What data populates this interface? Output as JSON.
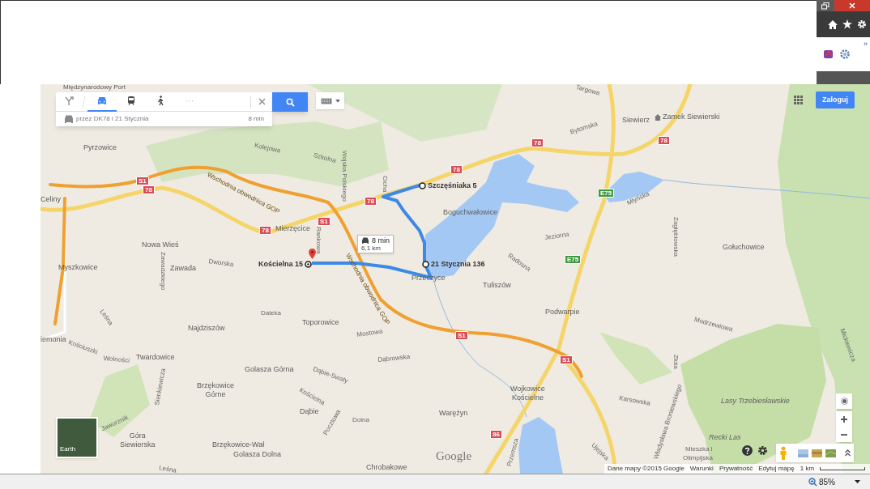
{
  "browser": {
    "overflow": "»",
    "zoom": "85%"
  },
  "directions": {
    "modes": [
      {
        "kind": "route",
        "selected": false
      },
      {
        "kind": "car",
        "selected": true
      },
      {
        "kind": "train",
        "selected": false
      },
      {
        "kind": "walk",
        "selected": false
      },
      {
        "kind": "more",
        "label": "···",
        "selected": false
      }
    ],
    "route": {
      "via": "przez DK78 i 21 Stycznia",
      "time": "8 min"
    }
  },
  "account": {
    "sign_in": "Zaloguj"
  },
  "map": {
    "partial_label": "Międzynarodowy Port",
    "places": [
      {
        "text": "Pyrzowice"
      },
      {
        "text": "Celiny"
      },
      {
        "text": "Mierzęcice"
      },
      {
        "text": "Nowa Wieś"
      },
      {
        "text": "Myszkowice"
      },
      {
        "text": "Zawada"
      },
      {
        "text": "Boguchwałowice"
      },
      {
        "text": "Siewierz"
      },
      {
        "text": "Zamek Siewierski",
        "kind": "poi"
      },
      {
        "text": "Gołuchowice"
      },
      {
        "text": "Tuliszów"
      },
      {
        "text": "Podwarpie"
      },
      {
        "text": "Najdziszów"
      },
      {
        "text": "Toporowice"
      },
      {
        "text": "Twardowice"
      },
      {
        "text": "Golasza Górna"
      },
      {
        "text": "Brzękowice\nGórne"
      },
      {
        "text": "Dąbie"
      },
      {
        "text": "Góra\nSiewierska"
      },
      {
        "text": "Brzękowice-Wał"
      },
      {
        "text": "Golasza Dolna"
      },
      {
        "text": "Wojkowice\nKościelne"
      },
      {
        "text": "Warężyn"
      },
      {
        "text": "Lasy Trzebiesławskie",
        "kind": "forest"
      },
      {
        "text": "Recki Las",
        "kind": "forest"
      },
      {
        "text": "iemonia"
      },
      {
        "text": "Chrobakowe"
      },
      {
        "text": "Przeczyce"
      }
    ],
    "streets": [
      "Kolejowa",
      "Szkolna",
      "Bytomska",
      "Targowa",
      "Młyńska",
      "Jeziorna",
      "Radosna",
      "Zagłębiowska",
      "Modrzewiowa",
      "Złota",
      "Mickiewicza",
      "Karsowska",
      "Władysława Broniewskiego",
      "Mieszka I",
      "Olimpijska",
      "Ujejska",
      "Przemsza",
      "Dworska",
      "Rankowa",
      "Zawadzkiego",
      "Wolności",
      "Kościuszki",
      "Leśna",
      "Daleka",
      "Mostowa",
      "Dąbrowska",
      "Dąbie-Swaty",
      "Kościelna",
      "Pocztowa",
      "Dolna",
      "Sienkiewicza",
      "Jaworznik",
      "Leśna",
      "Cicha",
      "Wojska Polskiego",
      "Wschodnia obwodnica GOP",
      "Wschodnia obwodnica GOP"
    ],
    "badges": [
      {
        "text": "78",
        "kind": "national"
      },
      {
        "text": "78",
        "kind": "national"
      },
      {
        "text": "78",
        "kind": "national"
      },
      {
        "text": "78",
        "kind": "national"
      },
      {
        "text": "78",
        "kind": "national"
      },
      {
        "text": "78",
        "kind": "national"
      },
      {
        "text": "S1",
        "kind": "national"
      },
      {
        "text": "S1",
        "kind": "national"
      },
      {
        "text": "S1",
        "kind": "national"
      },
      {
        "text": "S1",
        "kind": "national"
      },
      {
        "text": "E75",
        "kind": "european"
      },
      {
        "text": "E75",
        "kind": "european"
      },
      {
        "text": "86",
        "kind": "national"
      }
    ],
    "waypoints": [
      {
        "label": "Szczęśniaka 5",
        "kind": "stop"
      },
      {
        "label": "Kościelna 15",
        "kind": "origin"
      },
      {
        "label": "21 Stycznia 136",
        "kind": "stop"
      }
    ],
    "route_bubble": {
      "time": "8 min",
      "distance": "6,1 km"
    },
    "earth_label": "Earth",
    "logo": "Google"
  },
  "footer": {
    "links": [
      "Dane mapy ©2015 Google",
      "Warunki",
      "Prywatność",
      "Edytuj mapę"
    ],
    "scale": "1 km"
  }
}
